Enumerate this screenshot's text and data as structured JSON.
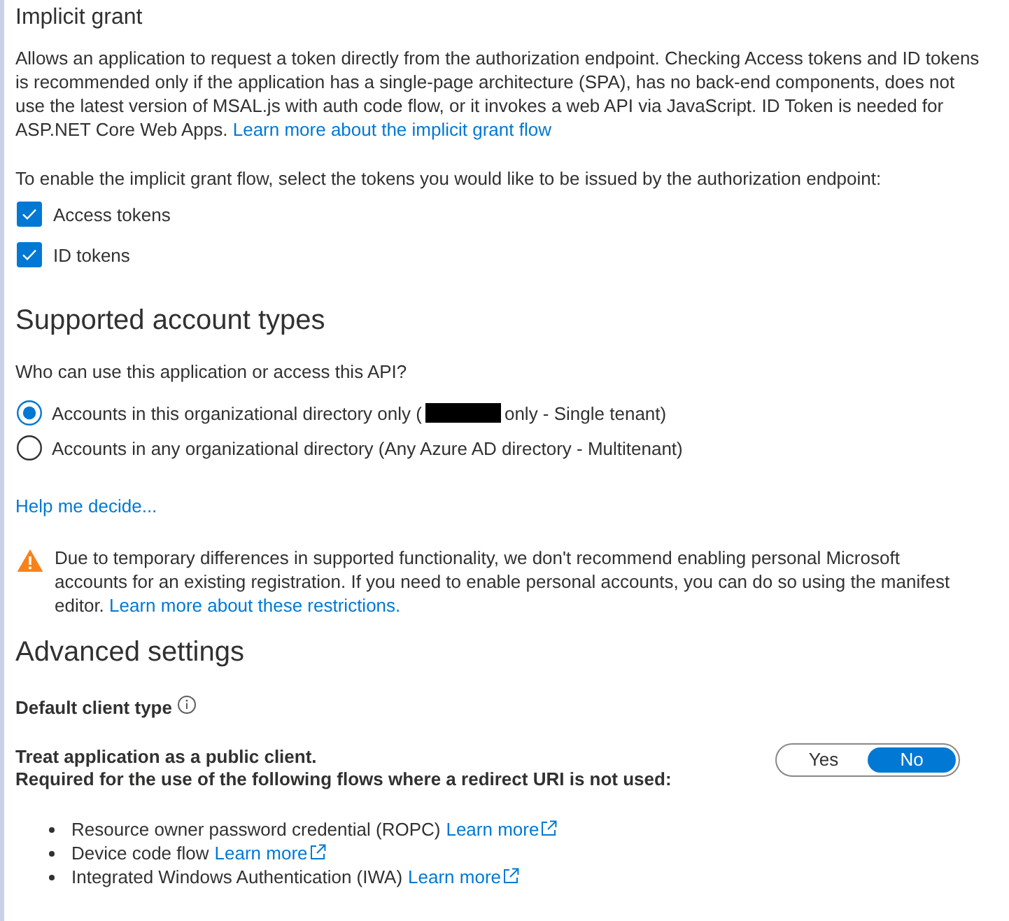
{
  "implicit_grant": {
    "title": "Implicit grant",
    "description": "Allows an application to request a token directly from the authorization endpoint. Checking Access tokens and ID tokens is recommended only if the application has a single-page architecture (SPA), has no back-end components, does not use the latest version of MSAL.js with auth code flow, or it invokes a web API via JavaScript. ID Token is needed for ASP.NET Core Web Apps.",
    "link": "Learn more about the implicit grant flow",
    "instruction": "To enable the implicit grant flow, select the tokens you would like to be issued by the authorization endpoint:",
    "tokens": [
      {
        "label": "Access tokens",
        "checked": true
      },
      {
        "label": "ID tokens",
        "checked": true
      }
    ]
  },
  "supported_account_types": {
    "title": "Supported account types",
    "question": "Who can use this application or access this API?",
    "options": [
      {
        "label": "Accounts in this organizational directory only (",
        "redacted": true,
        "label_after": "only - Single tenant)",
        "selected": true
      },
      {
        "label": "Accounts in any organizational directory (Any Azure AD directory - Multitenant)",
        "redacted": false,
        "selected": false
      }
    ],
    "help_link": "Help me decide...",
    "warning": {
      "text": "Due to temporary differences in supported functionality, we don't recommend enabling personal Microsoft accounts for an existing registration. If you need to enable personal accounts, you can do so using the manifest editor.",
      "link": "Learn more about these restrictions."
    }
  },
  "advanced_settings": {
    "title": "Advanced settings",
    "default_client_type": "Default client type",
    "public_client": {
      "label": "Treat application as a public client.",
      "description": "Required for the use of the following flows where a redirect URI is not used:",
      "toggle": [
        {
          "label": "Yes",
          "selected": false
        },
        {
          "label": "No",
          "selected": true
        }
      ],
      "flows": [
        {
          "text": "Resource owner password credential (ROPC)",
          "link": "Learn more"
        },
        {
          "text": "Device code flow",
          "link": "Learn more"
        },
        {
          "text": "Integrated Windows Authentication (IWA)",
          "link": "Learn more"
        }
      ]
    }
  }
}
